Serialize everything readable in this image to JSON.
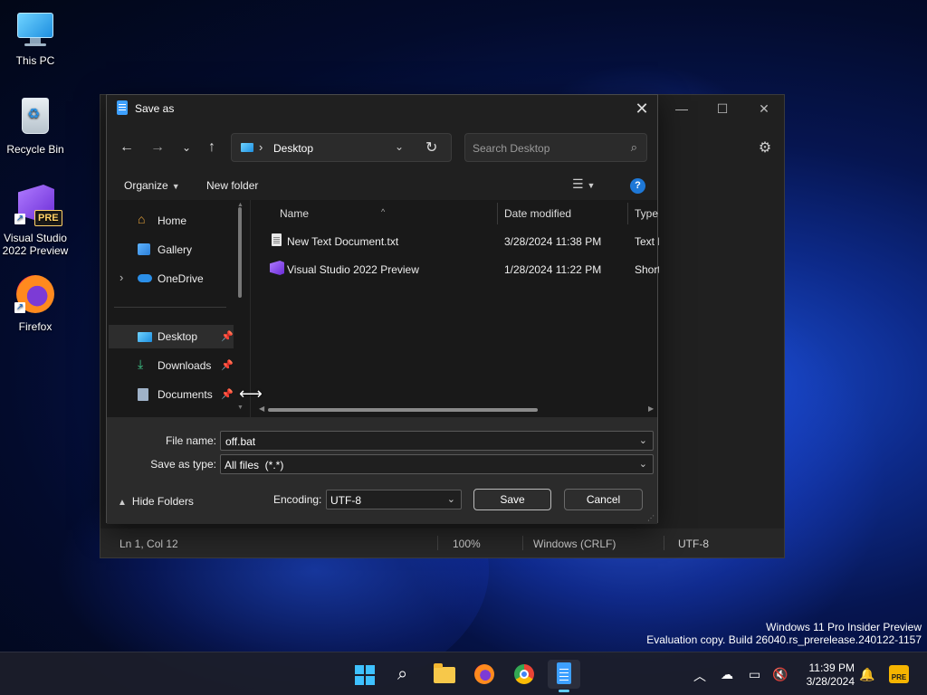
{
  "desktop": {
    "icons": [
      {
        "label": "This PC"
      },
      {
        "label": "Recycle Bin"
      },
      {
        "label": "Visual Studio 2022 Preview",
        "badge": "PRE"
      },
      {
        "label": "Firefox"
      }
    ],
    "watermark": {
      "line1": "Windows 11 Pro Insider Preview",
      "line2": "Evaluation copy. Build 26040.rs_prerelease.240122-1157"
    }
  },
  "notepad": {
    "status": {
      "position": "Ln 1, Col 12",
      "zoom": "100%",
      "line_ending": "Windows (CRLF)",
      "encoding": "UTF-8"
    }
  },
  "dialog": {
    "title": "Save as",
    "address": {
      "location": "Desktop"
    },
    "search": {
      "placeholder": "Search Desktop"
    },
    "toolbar": {
      "organize": "Organize",
      "new_folder": "New folder",
      "help": "?"
    },
    "nav_pane": {
      "items": [
        {
          "label": "Home",
          "icon": "home-icon"
        },
        {
          "label": "Gallery",
          "icon": "gallery-icon"
        },
        {
          "label": "OneDrive",
          "icon": "cloud-icon"
        },
        {
          "label": "Desktop",
          "icon": "desktop-icon",
          "pinned": true,
          "selected": true
        },
        {
          "label": "Downloads",
          "icon": "download-icon",
          "pinned": true
        },
        {
          "label": "Documents",
          "icon": "documents-icon",
          "pinned": true
        }
      ]
    },
    "file_list": {
      "columns": [
        "Name",
        "Date modified",
        "Type"
      ],
      "rows": [
        {
          "name": "New Text Document.txt",
          "date": "3/28/2024 11:38 PM",
          "type": "Text D",
          "icon": "text-file-icon"
        },
        {
          "name": "Visual Studio 2022 Preview",
          "date": "1/28/2024 11:22 PM",
          "type": "Short",
          "icon": "visual-studio-icon"
        }
      ]
    },
    "form": {
      "file_name_label": "File name:",
      "file_name_value": "off.bat",
      "save_type_label": "Save as type:",
      "save_type_value": "All files  (*.*)",
      "hide_folders": "Hide Folders",
      "encoding_label": "Encoding:",
      "encoding_value": "UTF-8",
      "save": "Save",
      "cancel": "Cancel"
    }
  },
  "taskbar": {
    "clock_time": "11:39 PM",
    "clock_date": "3/28/2024",
    "apps": [
      "start",
      "search",
      "file-explorer",
      "firefox",
      "chrome",
      "notepad"
    ],
    "active_app": "notepad",
    "pre_badge": "PRE"
  }
}
